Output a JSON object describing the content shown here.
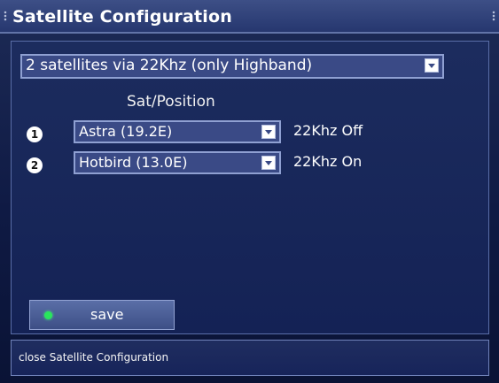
{
  "window": {
    "title": "Satellite Configuration"
  },
  "config": {
    "mode": "2 satellites via 22Khz (only Highband)",
    "column_heading": "Sat/Position"
  },
  "satellites": [
    {
      "index": "1",
      "name": "Astra (19.2E)",
      "tone": "22Khz Off"
    },
    {
      "index": "2",
      "name": "Hotbird (13.0E)",
      "tone": "22Khz On"
    }
  ],
  "actions": {
    "save_label": "save",
    "save_led_color": "#29e65c"
  },
  "status": {
    "text": "close Satellite Configuration"
  }
}
